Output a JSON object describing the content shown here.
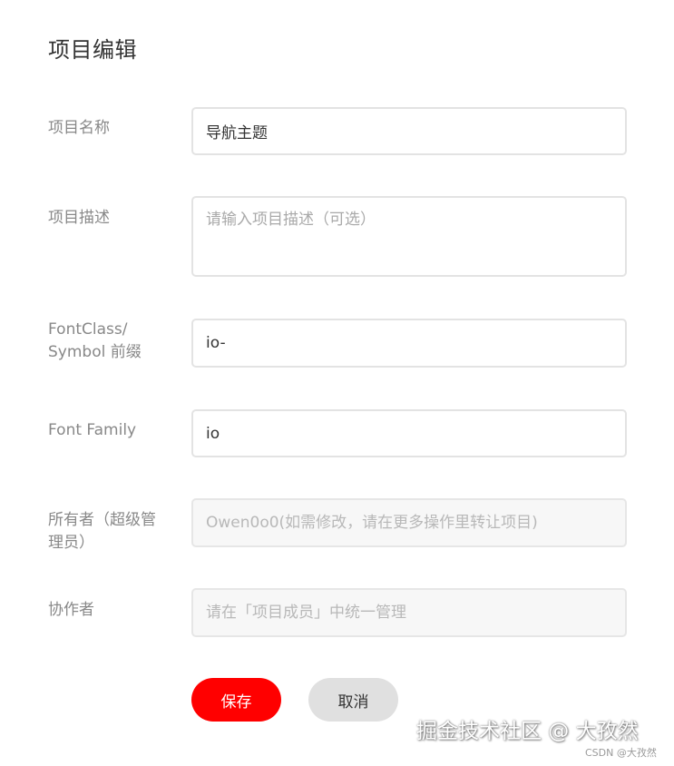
{
  "page": {
    "title": "项目编辑"
  },
  "form": {
    "name": {
      "label": "项目名称",
      "value": "导航主题"
    },
    "description": {
      "label": "项目描述",
      "placeholder": "请输入项目描述（可选）"
    },
    "prefix": {
      "label": "FontClass/ Symbol 前缀",
      "value": "io-"
    },
    "font_family": {
      "label": "Font Family",
      "value": "io"
    },
    "owner": {
      "label": "所有者（超级管理员）",
      "placeholder": "Owen0o0(如需修改，请在更多操作里转让项目)"
    },
    "collaborators": {
      "label": "协作者",
      "placeholder": "请在「项目成员」中统一管理"
    }
  },
  "actions": {
    "save_label": "保存",
    "cancel_label": "取消"
  },
  "watermark": {
    "main": "掘金技术社区 @ 大孜然",
    "sub": "CSDN @大孜然"
  },
  "colors": {
    "primary": "#ff0000",
    "secondary": "#e0e0e0",
    "label": "#888888",
    "border": "#e3e3e3"
  }
}
